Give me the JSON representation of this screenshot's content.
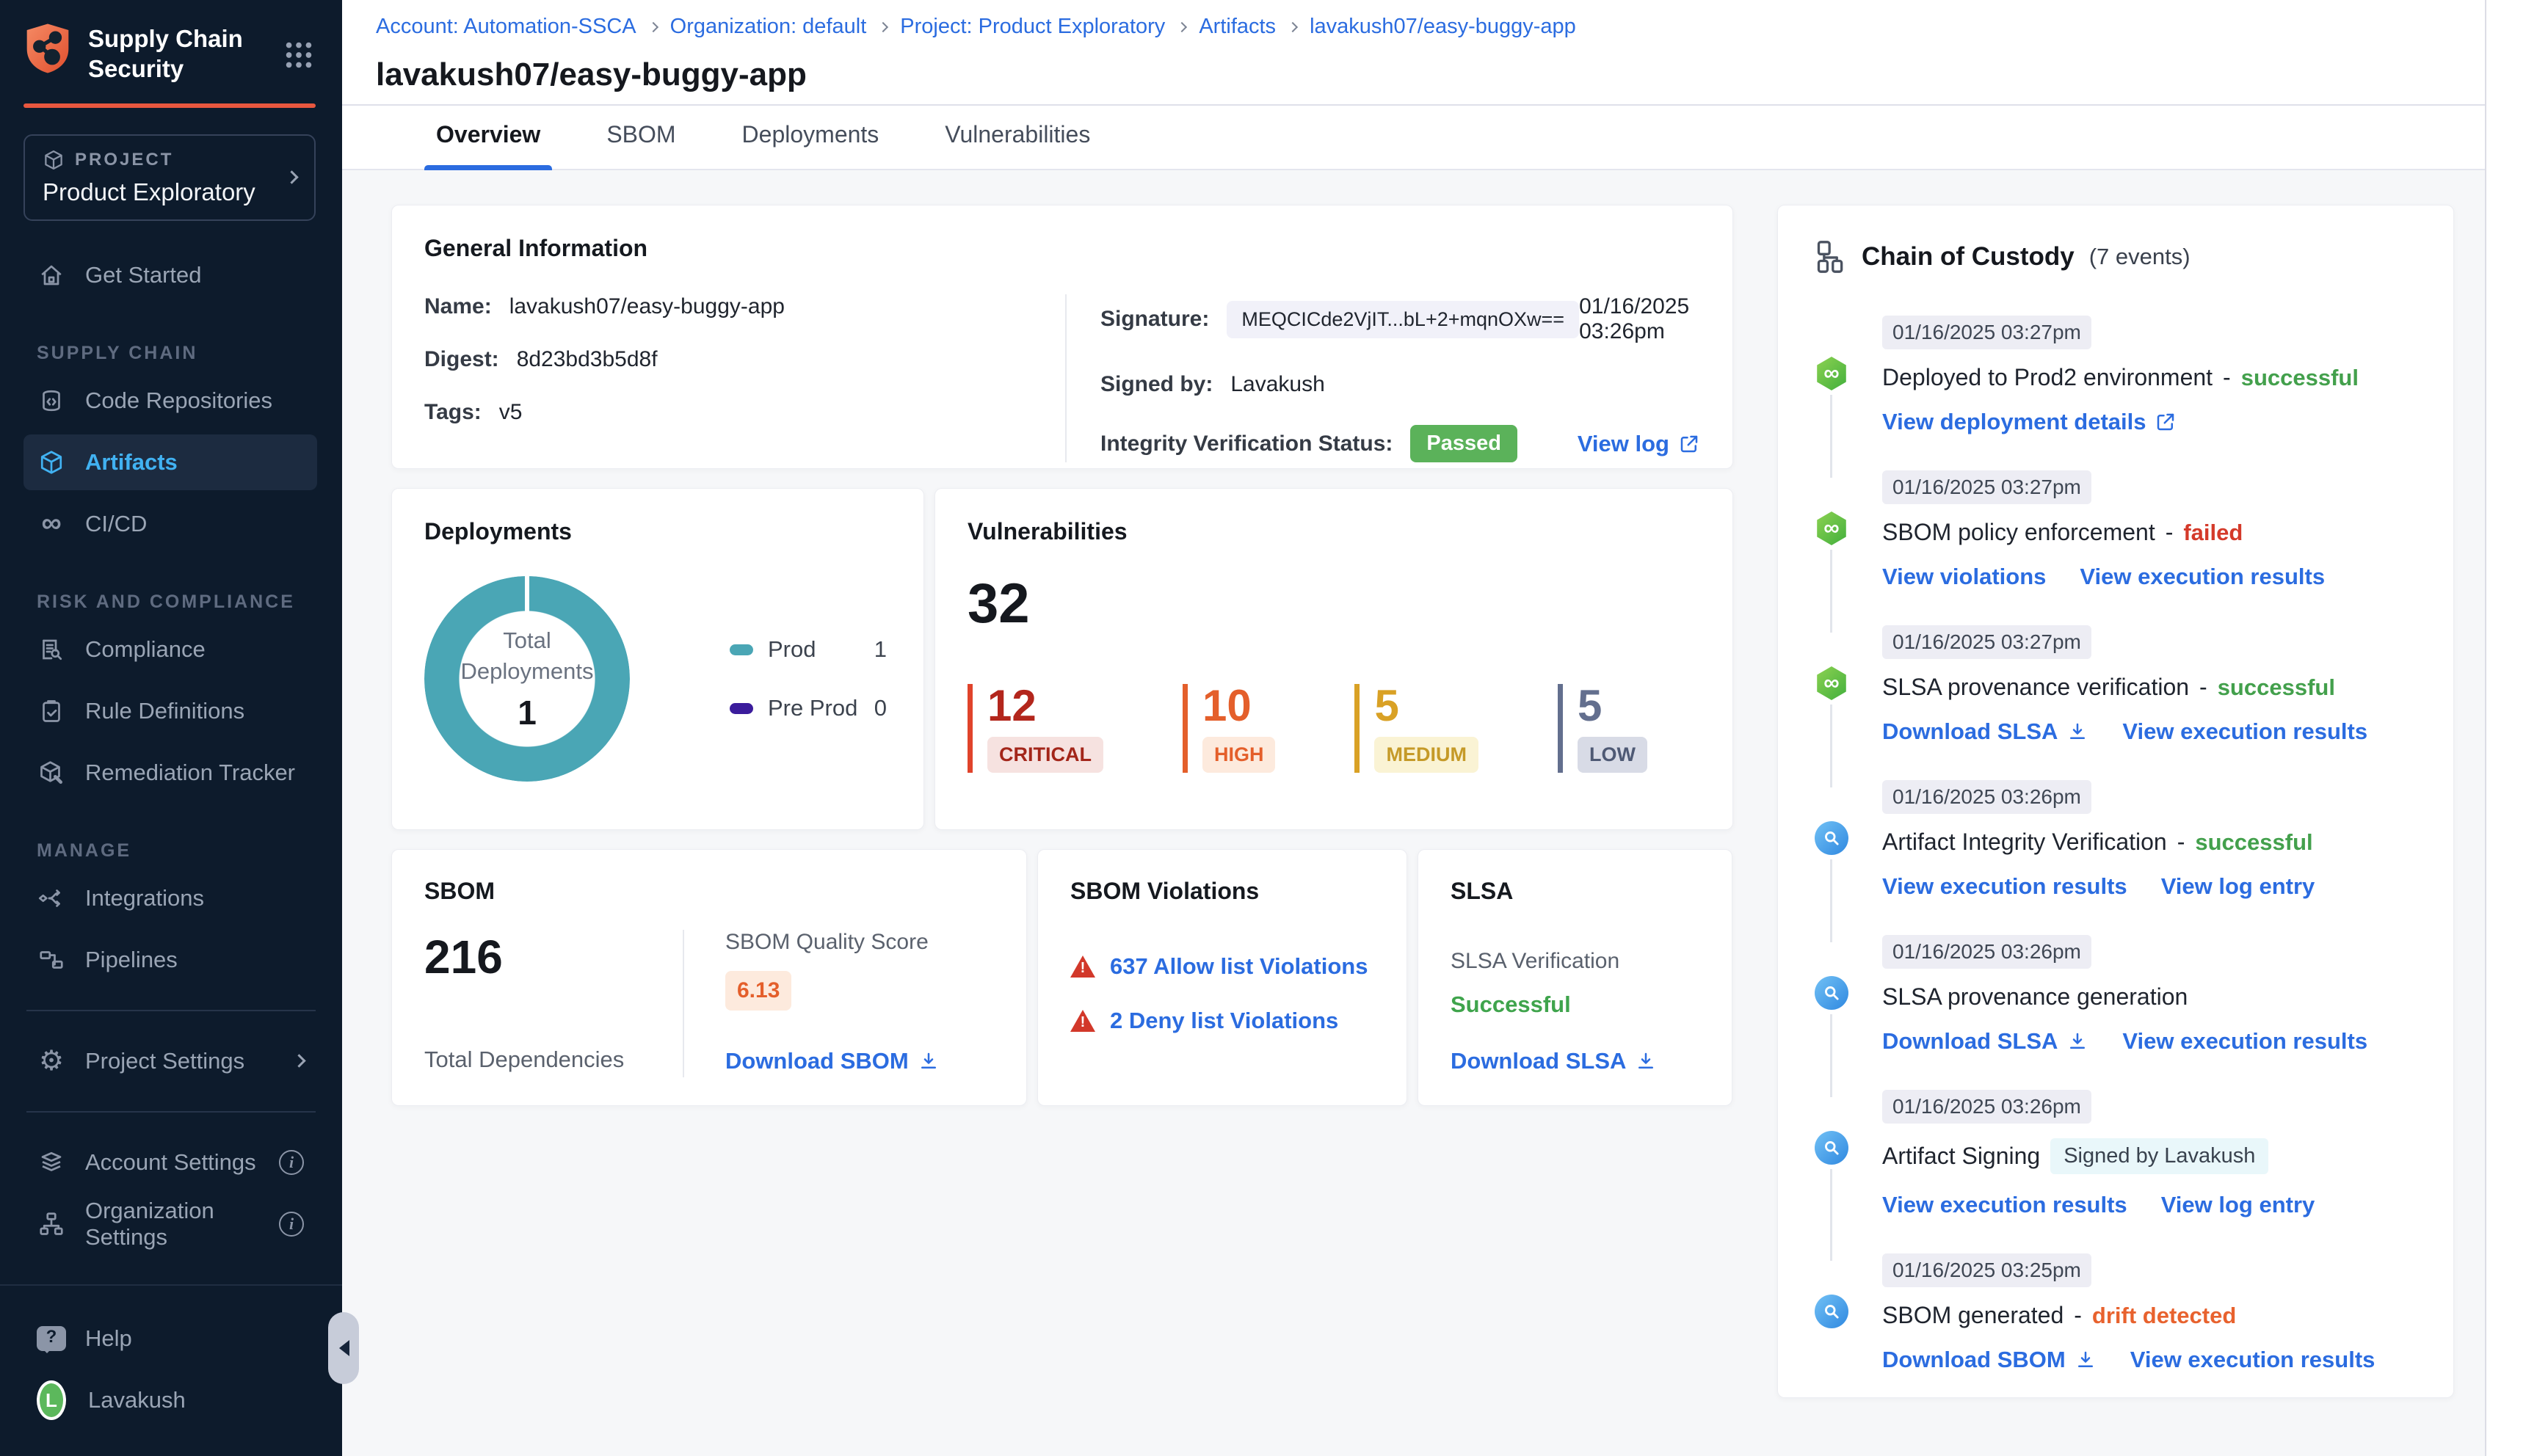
{
  "colors": {
    "accent_blue": "#2b6ce0",
    "sidebar_bg": "#0d1b2c",
    "sidebar_active_blue": "#41b2f2",
    "brand_orange": "#e8573f",
    "passed_badge_green": "#5bb25a",
    "success_green": "#43a04c",
    "failed_red": "#d43a2a",
    "drift_orange": "#e8622e",
    "donut_teal": "#4aa6b5",
    "preprod_purple": "#3b1c9c",
    "critical": "#b3261c",
    "high": "#e45f2b",
    "medium": "#d9a125",
    "low": "#636f8e"
  },
  "sidebar": {
    "logo_line1": "Supply Chain",
    "logo_line2": "Security",
    "logo_icon": "shield-network-icon",
    "apps_icon": "grid-dots-icon",
    "project_eyebrow": "PROJECT",
    "project_name": "Product Exploratory",
    "get_started": "Get Started",
    "section_supply_chain": "SUPPLY CHAIN",
    "code_repositories": "Code Repositories",
    "artifacts": "Artifacts",
    "cicd": "CI/CD",
    "section_risk": "RISK AND COMPLIANCE",
    "compliance": "Compliance",
    "rule_definitions": "Rule Definitions",
    "remediation_tracker": "Remediation Tracker",
    "section_manage": "MANAGE",
    "integrations": "Integrations",
    "pipelines": "Pipelines",
    "project_settings": "Project Settings",
    "account_settings": "Account Settings",
    "organization_settings": "Organization Settings",
    "help": "Help",
    "user_name": "Lavakush",
    "user_initial": "L"
  },
  "header": {
    "breadcrumb": [
      "Account: Automation-SSCA",
      "Organization: default",
      "Project: Product Exploratory",
      "Artifacts",
      "lavakush07/easy-buggy-app"
    ],
    "title": "lavakush07/easy-buggy-app",
    "tabs": [
      "Overview",
      "SBOM",
      "Deployments",
      "Vulnerabilities"
    ]
  },
  "general_info": {
    "title": "General Information",
    "name_label": "Name:",
    "name": "lavakush07/easy-buggy-app",
    "digest_label": "Digest:",
    "digest": "8d23bd3b5d8f",
    "tags_label": "Tags:",
    "tags": "v5",
    "signature_label": "Signature:",
    "signature": "MEQCICde2VjIT...bL+2+mqnOXw==",
    "signature_date": "01/16/2025 03:26pm",
    "signed_by_label": "Signed by:",
    "signed_by": "Lavakush",
    "integrity_label": "Integrity Verification Status:",
    "integrity_status": "Passed",
    "view_log": "View log"
  },
  "deployments": {
    "title": "Deployments",
    "center_label_1": "Total",
    "center_label_2": "Deployments",
    "total": "1",
    "legend": [
      {
        "label": "Prod",
        "count": "1",
        "color": "#4aa6b5"
      },
      {
        "label": "Pre Prod",
        "count": "0",
        "color": "#3b1c9c"
      }
    ]
  },
  "vulnerabilities": {
    "title": "Vulnerabilities",
    "total": "32",
    "severities": [
      {
        "label": "CRITICAL",
        "count": "12",
        "color": "#b3261c"
      },
      {
        "label": "HIGH",
        "count": "10",
        "color": "#e45f2b"
      },
      {
        "label": "MEDIUM",
        "count": "5",
        "color": "#d9a125"
      },
      {
        "label": "LOW",
        "count": "5",
        "color": "#636f8e"
      }
    ]
  },
  "sbom": {
    "title": "SBOM",
    "total": "216",
    "total_label": "Total Dependencies",
    "quality_label": "SBOM Quality Score",
    "quality_score": "6.13",
    "download": "Download SBOM"
  },
  "sbom_violations": {
    "title": "SBOM Violations",
    "rows": [
      {
        "label": "637 Allow list Violations",
        "icon": "warning-triangle-icon"
      },
      {
        "label": "2 Deny list Violations",
        "icon": "warning-triangle-icon"
      }
    ]
  },
  "slsa": {
    "title": "SLSA",
    "verification_label": "SLSA Verification",
    "status": "Successful",
    "download": "Download SLSA"
  },
  "chain": {
    "title": "Chain of Custody",
    "events_count": "(7 events)",
    "separator": "-",
    "events": [
      {
        "time": "01/16/2025 03:27pm",
        "title": "Deployed to Prod2 environment",
        "status": "successful",
        "icon": "pipeline-hexagon-icon",
        "links": [
          {
            "label": "View deployment details",
            "icon": "external-link-icon"
          }
        ]
      },
      {
        "time": "01/16/2025 03:27pm",
        "title": "SBOM policy enforcement",
        "status": "failed",
        "icon": "pipeline-hexagon-icon",
        "links": [
          {
            "label": "View violations"
          },
          {
            "label": "View execution results"
          }
        ]
      },
      {
        "time": "01/16/2025 03:27pm",
        "title": "SLSA provenance verification",
        "status": "successful",
        "icon": "pipeline-hexagon-icon",
        "links": [
          {
            "label": "Download SLSA",
            "icon": "download-icon"
          },
          {
            "label": "View execution results"
          }
        ]
      },
      {
        "time": "01/16/2025 03:26pm",
        "title": "Artifact Integrity Verification",
        "status": "successful",
        "icon": "artifact-scan-icon",
        "links": [
          {
            "label": "View execution results"
          },
          {
            "label": "View log entry"
          }
        ]
      },
      {
        "time": "01/16/2025 03:26pm",
        "title": "SLSA provenance generation",
        "status": "",
        "icon": "artifact-scan-icon",
        "links": [
          {
            "label": "Download SLSA",
            "icon": "download-icon"
          },
          {
            "label": "View execution results"
          }
        ]
      },
      {
        "time": "01/16/2025 03:26pm",
        "title": "Artifact Signing",
        "status": "",
        "badge": "Signed by Lavakush",
        "icon": "artifact-scan-icon",
        "links": [
          {
            "label": "View execution results"
          },
          {
            "label": "View log entry"
          }
        ]
      },
      {
        "time": "01/16/2025 03:25pm",
        "title": "SBOM generated",
        "status": "drift detected",
        "icon": "artifact-scan-icon",
        "links": [
          {
            "label": "Download SBOM",
            "icon": "download-icon"
          },
          {
            "label": "View execution results"
          }
        ]
      }
    ]
  }
}
